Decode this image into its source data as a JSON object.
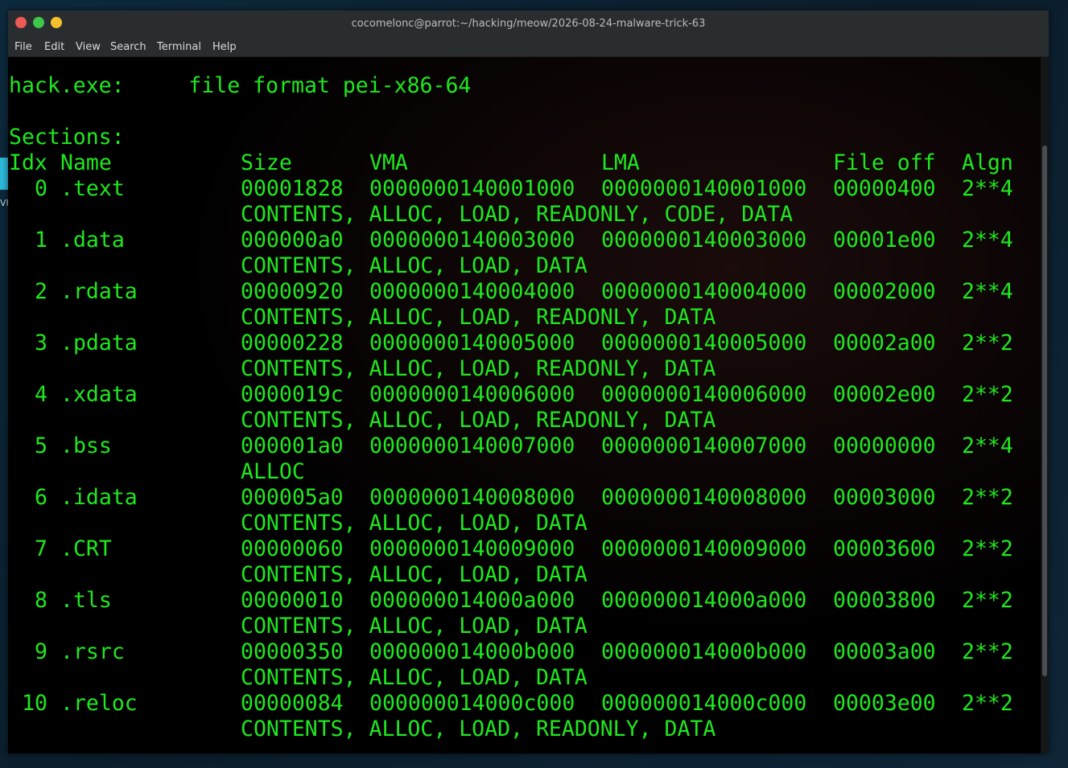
{
  "window": {
    "title": "cocomelonc@parrot:~/hacking/meow/2026-08-24-malware-trick-63"
  },
  "desktop": {
    "icon_label": "VFT-files"
  },
  "menu": {
    "items": [
      "File",
      "Edit",
      "View",
      "Search",
      "Terminal",
      "Help"
    ]
  },
  "terminal": {
    "file_line": "hack.exe:     file format pei-x86-64",
    "sections_label": "Sections:",
    "headers": {
      "idx": "Idx",
      "name": "Name",
      "size": "Size",
      "vma": "VMA",
      "lma": "LMA",
      "fileoff": "File off",
      "algn": "Algn"
    },
    "sections": [
      {
        "idx": "0",
        "name": ".text",
        "size": "00001828",
        "vma": "0000000140001000",
        "lma": "0000000140001000",
        "fileoff": "00000400",
        "algn": "2**4",
        "flags": "CONTENTS, ALLOC, LOAD, READONLY, CODE, DATA"
      },
      {
        "idx": "1",
        "name": ".data",
        "size": "000000a0",
        "vma": "0000000140003000",
        "lma": "0000000140003000",
        "fileoff": "00001e00",
        "algn": "2**4",
        "flags": "CONTENTS, ALLOC, LOAD, DATA"
      },
      {
        "idx": "2",
        "name": ".rdata",
        "size": "00000920",
        "vma": "0000000140004000",
        "lma": "0000000140004000",
        "fileoff": "00002000",
        "algn": "2**4",
        "flags": "CONTENTS, ALLOC, LOAD, READONLY, DATA"
      },
      {
        "idx": "3",
        "name": ".pdata",
        "size": "00000228",
        "vma": "0000000140005000",
        "lma": "0000000140005000",
        "fileoff": "00002a00",
        "algn": "2**2",
        "flags": "CONTENTS, ALLOC, LOAD, READONLY, DATA"
      },
      {
        "idx": "4",
        "name": ".xdata",
        "size": "0000019c",
        "vma": "0000000140006000",
        "lma": "0000000140006000",
        "fileoff": "00002e00",
        "algn": "2**2",
        "flags": "CONTENTS, ALLOC, LOAD, READONLY, DATA"
      },
      {
        "idx": "5",
        "name": ".bss",
        "size": "000001a0",
        "vma": "0000000140007000",
        "lma": "0000000140007000",
        "fileoff": "00000000",
        "algn": "2**4",
        "flags": "ALLOC"
      },
      {
        "idx": "6",
        "name": ".idata",
        "size": "000005a0",
        "vma": "0000000140008000",
        "lma": "0000000140008000",
        "fileoff": "00003000",
        "algn": "2**2",
        "flags": "CONTENTS, ALLOC, LOAD, DATA"
      },
      {
        "idx": "7",
        "name": ".CRT",
        "size": "00000060",
        "vma": "0000000140009000",
        "lma": "0000000140009000",
        "fileoff": "00003600",
        "algn": "2**2",
        "flags": "CONTENTS, ALLOC, LOAD, DATA"
      },
      {
        "idx": "8",
        "name": ".tls",
        "size": "00000010",
        "vma": "000000014000a000",
        "lma": "000000014000a000",
        "fileoff": "00003800",
        "algn": "2**2",
        "flags": "CONTENTS, ALLOC, LOAD, DATA"
      },
      {
        "idx": "9",
        "name": ".rsrc",
        "size": "00000350",
        "vma": "000000014000b000",
        "lma": "000000014000b000",
        "fileoff": "00003a00",
        "algn": "2**2",
        "flags": "CONTENTS, ALLOC, LOAD, DATA"
      },
      {
        "idx": "10",
        "name": ".reloc",
        "size": "00000084",
        "vma": "000000014000c000",
        "lma": "000000014000c000",
        "fileoff": "00003e00",
        "algn": "2**2",
        "flags": "CONTENTS, ALLOC, LOAD, READONLY, DATA"
      }
    ]
  },
  "colors": {
    "terminal_text": "#1fe81f",
    "terminal_bg": "#000000",
    "titlebar": "#2a2d30"
  }
}
